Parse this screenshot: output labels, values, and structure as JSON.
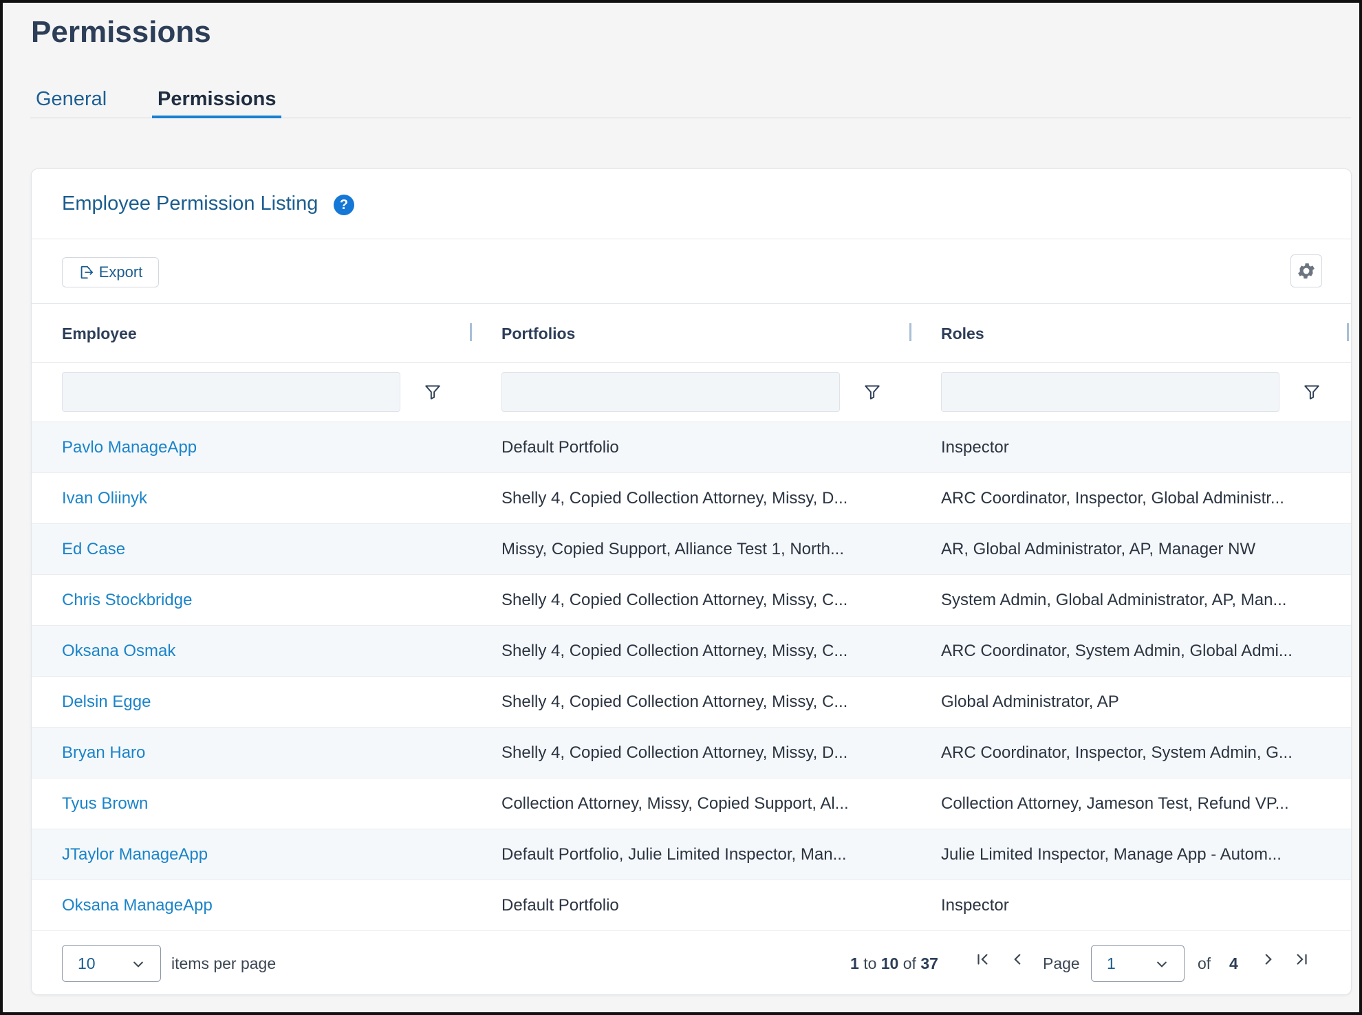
{
  "page": {
    "title": "Permissions"
  },
  "tabs": [
    {
      "label": "General",
      "active": false
    },
    {
      "label": "Permissions",
      "active": true
    }
  ],
  "card": {
    "title": "Employee Permission Listing",
    "help_icon": "help-circle-icon",
    "export_label": "Export",
    "settings_icon": "gear-icon"
  },
  "table": {
    "columns": [
      "Employee",
      "Portfolios",
      "Roles"
    ],
    "filters": [
      {
        "value": "",
        "placeholder": ""
      },
      {
        "value": "",
        "placeholder": ""
      },
      {
        "value": "",
        "placeholder": ""
      }
    ],
    "rows": [
      {
        "employee": "Pavlo ManageApp",
        "portfolios": "Default Portfolio",
        "roles": "Inspector"
      },
      {
        "employee": "Ivan Oliinyk",
        "portfolios": "Shelly 4, Copied Collection Attorney, Missy, D...",
        "roles": "ARC Coordinator, Inspector, Global Administr..."
      },
      {
        "employee": "Ed Case",
        "portfolios": "Missy, Copied Support, Alliance Test 1, North...",
        "roles": "AR, Global Administrator, AP, Manager NW"
      },
      {
        "employee": "Chris Stockbridge",
        "portfolios": "Shelly 4, Copied Collection Attorney, Missy, C...",
        "roles": "System Admin, Global Administrator, AP, Man..."
      },
      {
        "employee": "Oksana Osmak",
        "portfolios": "Shelly 4, Copied Collection Attorney, Missy, C...",
        "roles": "ARC Coordinator, System Admin, Global Admi..."
      },
      {
        "employee": "Delsin Egge",
        "portfolios": "Shelly 4, Copied Collection Attorney, Missy, C...",
        "roles": "Global Administrator, AP"
      },
      {
        "employee": "Bryan Haro",
        "portfolios": "Shelly 4, Copied Collection Attorney, Missy, D...",
        "roles": "ARC Coordinator, Inspector, System Admin, G..."
      },
      {
        "employee": "Tyus Brown",
        "portfolios": "Collection Attorney, Missy, Copied Support, Al...",
        "roles": "Collection Attorney, Jameson Test, Refund VP..."
      },
      {
        "employee": "JTaylor ManageApp",
        "portfolios": "Default Portfolio, Julie Limited Inspector, Man...",
        "roles": "Julie Limited Inspector, Manage App - Autom..."
      },
      {
        "employee": "Oksana ManageApp",
        "portfolios": "Default Portfolio",
        "roles": "Inspector"
      }
    ]
  },
  "pagination": {
    "page_size": "10",
    "items_per_page_label": "items per page",
    "range_start": "1",
    "to_label": "to",
    "range_end": "10",
    "of_label": "of",
    "total": "37",
    "page_label": "Page",
    "current_page": "1",
    "of_pages_label": "of",
    "total_pages": "4"
  },
  "colors": {
    "accent": "#1a7fd1",
    "link": "#1a84c9",
    "title": "#2d3e58"
  }
}
